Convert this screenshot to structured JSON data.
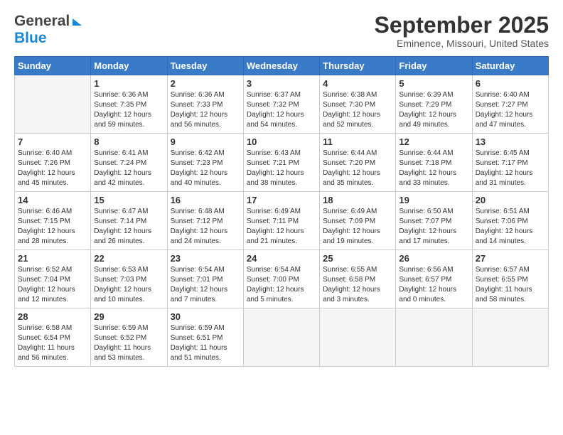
{
  "header": {
    "logo_line1": "General",
    "logo_line2": "Blue",
    "month": "September 2025",
    "location": "Eminence, Missouri, United States"
  },
  "days_of_week": [
    "Sunday",
    "Monday",
    "Tuesday",
    "Wednesday",
    "Thursday",
    "Friday",
    "Saturday"
  ],
  "weeks": [
    [
      {
        "day": "",
        "info": ""
      },
      {
        "day": "1",
        "info": "Sunrise: 6:36 AM\nSunset: 7:35 PM\nDaylight: 12 hours\nand 59 minutes."
      },
      {
        "day": "2",
        "info": "Sunrise: 6:36 AM\nSunset: 7:33 PM\nDaylight: 12 hours\nand 56 minutes."
      },
      {
        "day": "3",
        "info": "Sunrise: 6:37 AM\nSunset: 7:32 PM\nDaylight: 12 hours\nand 54 minutes."
      },
      {
        "day": "4",
        "info": "Sunrise: 6:38 AM\nSunset: 7:30 PM\nDaylight: 12 hours\nand 52 minutes."
      },
      {
        "day": "5",
        "info": "Sunrise: 6:39 AM\nSunset: 7:29 PM\nDaylight: 12 hours\nand 49 minutes."
      },
      {
        "day": "6",
        "info": "Sunrise: 6:40 AM\nSunset: 7:27 PM\nDaylight: 12 hours\nand 47 minutes."
      }
    ],
    [
      {
        "day": "7",
        "info": "Sunrise: 6:40 AM\nSunset: 7:26 PM\nDaylight: 12 hours\nand 45 minutes."
      },
      {
        "day": "8",
        "info": "Sunrise: 6:41 AM\nSunset: 7:24 PM\nDaylight: 12 hours\nand 42 minutes."
      },
      {
        "day": "9",
        "info": "Sunrise: 6:42 AM\nSunset: 7:23 PM\nDaylight: 12 hours\nand 40 minutes."
      },
      {
        "day": "10",
        "info": "Sunrise: 6:43 AM\nSunset: 7:21 PM\nDaylight: 12 hours\nand 38 minutes."
      },
      {
        "day": "11",
        "info": "Sunrise: 6:44 AM\nSunset: 7:20 PM\nDaylight: 12 hours\nand 35 minutes."
      },
      {
        "day": "12",
        "info": "Sunrise: 6:44 AM\nSunset: 7:18 PM\nDaylight: 12 hours\nand 33 minutes."
      },
      {
        "day": "13",
        "info": "Sunrise: 6:45 AM\nSunset: 7:17 PM\nDaylight: 12 hours\nand 31 minutes."
      }
    ],
    [
      {
        "day": "14",
        "info": "Sunrise: 6:46 AM\nSunset: 7:15 PM\nDaylight: 12 hours\nand 28 minutes."
      },
      {
        "day": "15",
        "info": "Sunrise: 6:47 AM\nSunset: 7:14 PM\nDaylight: 12 hours\nand 26 minutes."
      },
      {
        "day": "16",
        "info": "Sunrise: 6:48 AM\nSunset: 7:12 PM\nDaylight: 12 hours\nand 24 minutes."
      },
      {
        "day": "17",
        "info": "Sunrise: 6:49 AM\nSunset: 7:11 PM\nDaylight: 12 hours\nand 21 minutes."
      },
      {
        "day": "18",
        "info": "Sunrise: 6:49 AM\nSunset: 7:09 PM\nDaylight: 12 hours\nand 19 minutes."
      },
      {
        "day": "19",
        "info": "Sunrise: 6:50 AM\nSunset: 7:07 PM\nDaylight: 12 hours\nand 17 minutes."
      },
      {
        "day": "20",
        "info": "Sunrise: 6:51 AM\nSunset: 7:06 PM\nDaylight: 12 hours\nand 14 minutes."
      }
    ],
    [
      {
        "day": "21",
        "info": "Sunrise: 6:52 AM\nSunset: 7:04 PM\nDaylight: 12 hours\nand 12 minutes."
      },
      {
        "day": "22",
        "info": "Sunrise: 6:53 AM\nSunset: 7:03 PM\nDaylight: 12 hours\nand 10 minutes."
      },
      {
        "day": "23",
        "info": "Sunrise: 6:54 AM\nSunset: 7:01 PM\nDaylight: 12 hours\nand 7 minutes."
      },
      {
        "day": "24",
        "info": "Sunrise: 6:54 AM\nSunset: 7:00 PM\nDaylight: 12 hours\nand 5 minutes."
      },
      {
        "day": "25",
        "info": "Sunrise: 6:55 AM\nSunset: 6:58 PM\nDaylight: 12 hours\nand 3 minutes."
      },
      {
        "day": "26",
        "info": "Sunrise: 6:56 AM\nSunset: 6:57 PM\nDaylight: 12 hours\nand 0 minutes."
      },
      {
        "day": "27",
        "info": "Sunrise: 6:57 AM\nSunset: 6:55 PM\nDaylight: 11 hours\nand 58 minutes."
      }
    ],
    [
      {
        "day": "28",
        "info": "Sunrise: 6:58 AM\nSunset: 6:54 PM\nDaylight: 11 hours\nand 56 minutes."
      },
      {
        "day": "29",
        "info": "Sunrise: 6:59 AM\nSunset: 6:52 PM\nDaylight: 11 hours\nand 53 minutes."
      },
      {
        "day": "30",
        "info": "Sunrise: 6:59 AM\nSunset: 6:51 PM\nDaylight: 11 hours\nand 51 minutes."
      },
      {
        "day": "",
        "info": ""
      },
      {
        "day": "",
        "info": ""
      },
      {
        "day": "",
        "info": ""
      },
      {
        "day": "",
        "info": ""
      }
    ]
  ]
}
